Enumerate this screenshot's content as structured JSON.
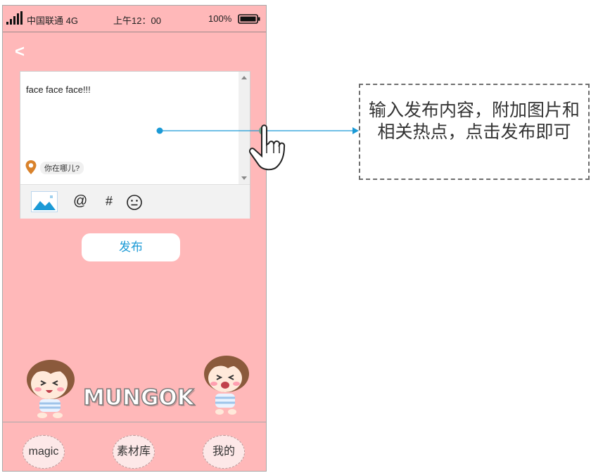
{
  "status_bar": {
    "carrier": "中国联通 4G",
    "time": "上午12：00",
    "battery": "100%"
  },
  "nav": {
    "back_label": "<"
  },
  "editor": {
    "text": "face face face!!!",
    "location_placeholder": "你在哪儿?"
  },
  "toolbar": {
    "image_icon": "image-icon",
    "at_label": "@",
    "hash_label": "#",
    "emoji_icon": "emoji-icon"
  },
  "publish_button": "发布",
  "brand": {
    "logo_text": "MUNGOK"
  },
  "bottom_nav": [
    {
      "label": "magic"
    },
    {
      "label": "素材库"
    },
    {
      "label": "我的"
    }
  ],
  "annotation": {
    "text": "输入发布内容，附加图片和相关热点，点击发布即可"
  },
  "colors": {
    "phone_background": "#ffb8b9",
    "accent_blue": "#1b9ad6",
    "location_pin": "#d9822b"
  }
}
